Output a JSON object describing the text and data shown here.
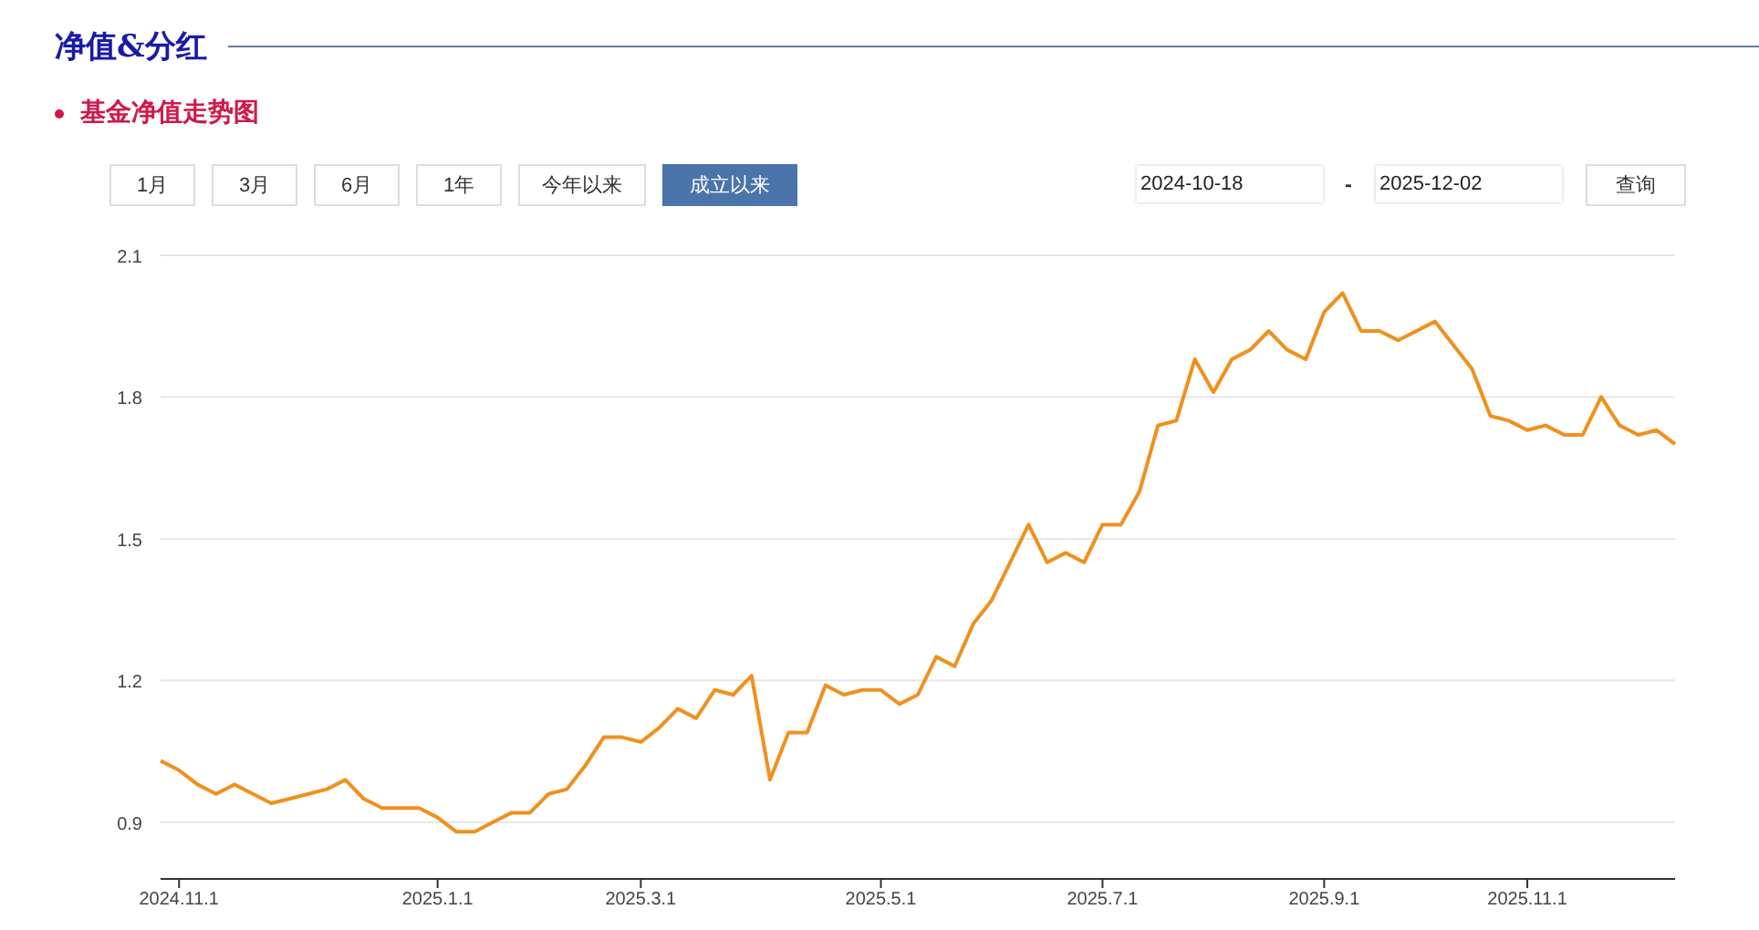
{
  "section_title": "净值&分红",
  "subsection_title": "基金净值走势图",
  "range_buttons": [
    {
      "label": "1月",
      "selected": false
    },
    {
      "label": "3月",
      "selected": false
    },
    {
      "label": "6月",
      "selected": false
    },
    {
      "label": "1年",
      "selected": false
    },
    {
      "label": "今年以来",
      "selected": false
    },
    {
      "label": "成立以来",
      "selected": true
    }
  ],
  "date_range": {
    "start": "2024-10-18",
    "separator": "-",
    "end": "2025-12-02",
    "query_button": "查询"
  },
  "chart_data": {
    "type": "line",
    "categories": [
      null,
      "2024.11.1",
      null,
      null,
      null,
      null,
      null,
      null,
      null,
      null,
      null,
      null,
      null,
      null,
      null,
      "2025.1.1",
      null,
      null,
      null,
      null,
      null,
      null,
      null,
      null,
      null,
      null,
      "2025.3.1",
      null,
      null,
      null,
      null,
      null,
      null,
      null,
      null,
      null,
      null,
      null,
      null,
      "2025.5.1",
      null,
      null,
      null,
      null,
      null,
      null,
      null,
      null,
      null,
      null,
      null,
      "2025.7.1",
      null,
      null,
      null,
      null,
      null,
      null,
      null,
      null,
      null,
      null,
      null,
      "2025.9.1",
      null,
      null,
      null,
      null,
      null,
      null,
      null,
      null,
      null,
      null,
      "2025.11.1",
      null,
      null,
      null,
      null,
      null,
      null,
      null,
      null
    ],
    "series": [
      {
        "color": "#f0901e",
        "values": [
          1.03,
          1.01,
          0.98,
          0.96,
          0.98,
          0.96,
          0.94,
          0.95,
          0.96,
          0.97,
          0.99,
          0.95,
          0.93,
          0.93,
          0.93,
          0.91,
          0.88,
          0.88,
          0.9,
          0.92,
          0.92,
          0.96,
          0.97,
          1.02,
          1.08,
          1.08,
          1.07,
          1.1,
          1.14,
          1.12,
          1.18,
          1.17,
          1.21,
          0.99,
          1.09,
          1.09,
          1.19,
          1.17,
          1.18,
          1.18,
          1.15,
          1.17,
          1.25,
          1.23,
          1.32,
          1.37,
          1.45,
          1.53,
          1.45,
          1.47,
          1.45,
          1.53,
          1.53,
          1.6,
          1.74,
          1.75,
          1.88,
          1.81,
          1.88,
          1.9,
          1.94,
          1.9,
          1.88,
          1.98,
          2.02,
          1.94,
          1.94,
          1.92,
          1.94,
          1.96,
          1.91,
          1.86,
          1.76,
          1.75,
          1.73,
          1.74,
          1.72,
          1.72,
          1.8,
          1.74,
          1.72,
          1.73,
          1.7
        ]
      }
    ],
    "ylim": [
      0.78,
      2.1
    ],
    "grid": true,
    "yticks": [
      {
        "value": 0.9,
        "label": "0.9"
      },
      {
        "value": 1.2,
        "label": "1.2"
      },
      {
        "value": 1.5,
        "label": "1.5"
      },
      {
        "value": 1.8,
        "label": "1.8"
      },
      {
        "value": 2.1,
        "label": "2.1"
      }
    ]
  }
}
